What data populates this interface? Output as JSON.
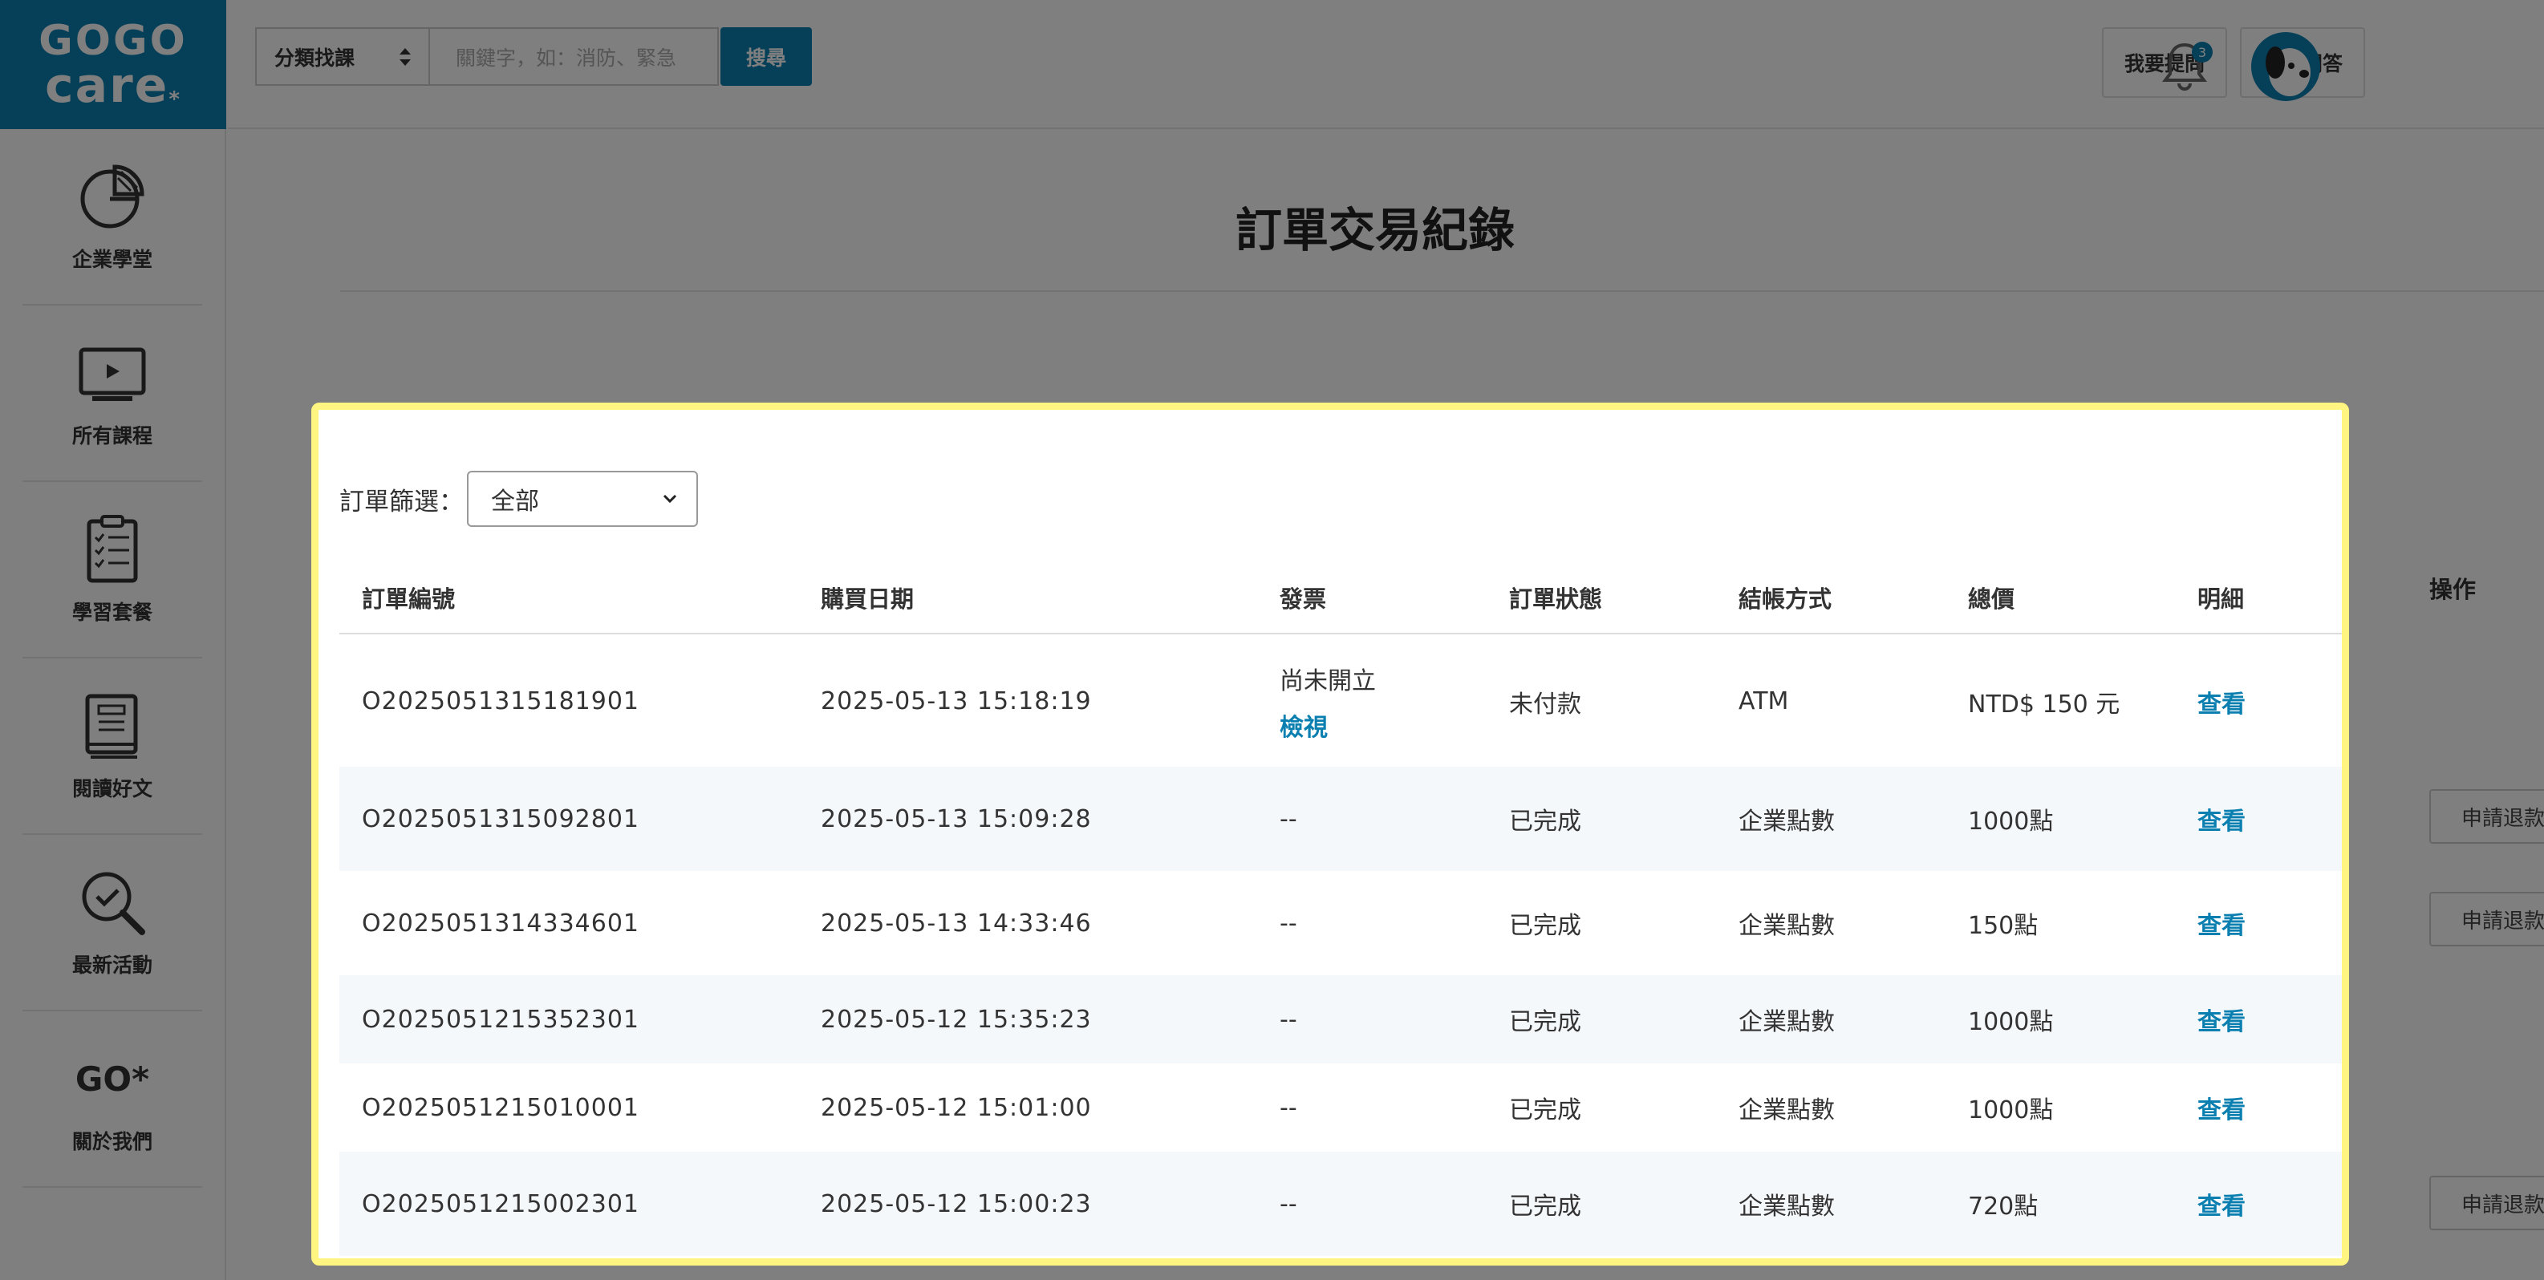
{
  "sidebar": {
    "logo_line1": "GOGO",
    "logo_line2": "care",
    "logo_star": "*",
    "items": [
      {
        "label": "企業學堂"
      },
      {
        "label": "所有課程"
      },
      {
        "label": "學習套餐"
      },
      {
        "label": "閱讀好文"
      },
      {
        "label": "最新活動"
      },
      {
        "label": "關於我們",
        "logo_text": "GO*"
      }
    ]
  },
  "header": {
    "category_label": "分類找課",
    "search_placeholder": "關鍵字，如：消防、緊急",
    "search_button": "搜尋",
    "ask_button": "我要提問",
    "faq_button": "常見問答",
    "notification_count": "3"
  },
  "main": {
    "page_title": "訂單交易紀錄",
    "bg_action_header": "操作",
    "bg_refund_label": "申請退款"
  },
  "modal": {
    "filter_label": "訂單篩選：",
    "filter_value": "全部",
    "columns": [
      "訂單編號",
      "購買日期",
      "發票",
      "訂單狀態",
      "結帳方式",
      "總價",
      "明細"
    ],
    "rows": [
      {
        "order_no": "O2025051315181901",
        "date": "2025-05-13 15:18:19",
        "invoice": "尚未開立",
        "invoice_link": "檢視",
        "status": "未付款",
        "payment": "ATM",
        "total": "NTD$ 150 元",
        "detail": "查看"
      },
      {
        "order_no": "O2025051315092801",
        "date": "2025-05-13 15:09:28",
        "invoice": "--",
        "status": "已完成",
        "payment": "企業點數",
        "total": "1000點",
        "detail": "查看"
      },
      {
        "order_no": "O2025051314334601",
        "date": "2025-05-13 14:33:46",
        "invoice": "--",
        "status": "已完成",
        "payment": "企業點數",
        "total": "150點",
        "detail": "查看"
      },
      {
        "order_no": "O2025051215352301",
        "date": "2025-05-12 15:35:23",
        "invoice": "--",
        "status": "已完成",
        "payment": "企業點數",
        "total": "1000點",
        "detail": "查看"
      },
      {
        "order_no": "O2025051215010001",
        "date": "2025-05-12 15:01:00",
        "invoice": "--",
        "status": "已完成",
        "payment": "企業點數",
        "total": "1000點",
        "detail": "查看"
      },
      {
        "order_no": "O2025051215002301",
        "date": "2025-05-12 15:00:23",
        "invoice": "--",
        "status": "已完成",
        "payment": "企業點數",
        "total": "720點",
        "detail": "查看"
      }
    ]
  },
  "colors": {
    "brand": "#0a7fb0",
    "modal_highlight": "#fff580"
  }
}
